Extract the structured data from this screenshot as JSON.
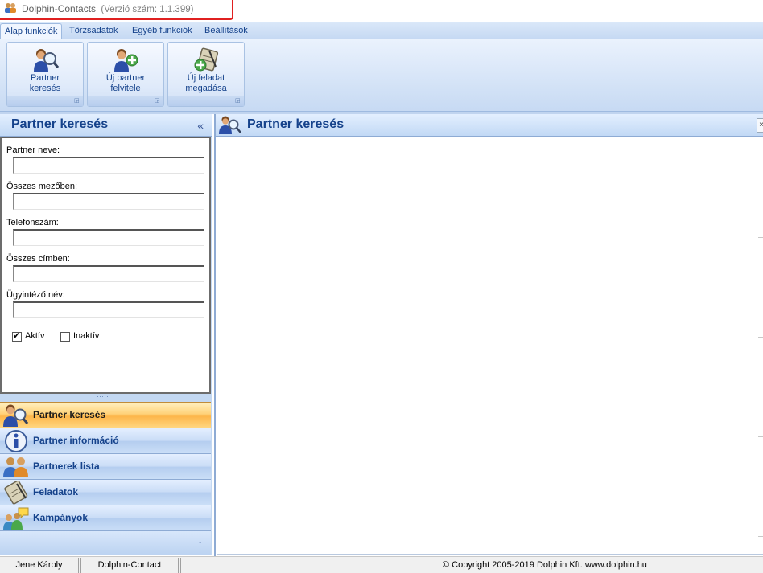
{
  "window": {
    "app_name": "Dolphin-Contacts",
    "version": "(Verzió szám: 1.1.399)"
  },
  "ribbon": {
    "tabs": [
      {
        "label": "Alap funkciók",
        "active": true
      },
      {
        "label": "Törzsadatok",
        "active": false
      },
      {
        "label": "Egyéb funkciók",
        "active": false
      },
      {
        "label": "Beállítások",
        "active": false
      }
    ],
    "buttons": [
      {
        "label": "Partner\nkeresés",
        "icon": "partner-search-icon"
      },
      {
        "label": "Új partner\nfelvitele",
        "icon": "add-partner-icon"
      },
      {
        "label": "Új feladat\nmegadása",
        "icon": "add-task-icon"
      }
    ],
    "launcher_glyph": "◲"
  },
  "left_panel": {
    "title": "Partner keresés",
    "collapse_glyph": "«",
    "fields": [
      {
        "label": "Partner neve:",
        "value": ""
      },
      {
        "label": "Összes mezőben:",
        "value": ""
      },
      {
        "label": "Telefonszám:",
        "value": ""
      },
      {
        "label": "Összes címben:",
        "value": ""
      },
      {
        "label": "Ügyintéző név:",
        "value": ""
      }
    ],
    "checkboxes": [
      {
        "label": "Aktív",
        "checked": true
      },
      {
        "label": "Inaktív",
        "checked": false
      }
    ],
    "grip_glyph": "·····",
    "nav_items": [
      {
        "label": "Partner keresés",
        "icon": "partner-search-icon",
        "active": true
      },
      {
        "label": "Partner információ",
        "icon": "info-icon",
        "active": false
      },
      {
        "label": "Partnerek lista",
        "icon": "partners-list-icon",
        "active": false
      },
      {
        "label": "Feladatok",
        "icon": "tasks-icon",
        "active": false
      },
      {
        "label": "Kampányok",
        "icon": "campaigns-icon",
        "active": false
      }
    ],
    "footer_glyph": "⌄"
  },
  "main": {
    "title": "Partner keresés",
    "icon": "partner-search-icon",
    "close_glyph": "×"
  },
  "statusbar": {
    "user": "Jene Károly",
    "app": "Dolphin-Contact",
    "copyright": "© Copyright 2005-2019 Dolphin Kft. www.dolphin.hu"
  },
  "colors": {
    "accent_text": "#15428b",
    "active_nav": "#fdb64a",
    "title_border": "#e02020"
  }
}
